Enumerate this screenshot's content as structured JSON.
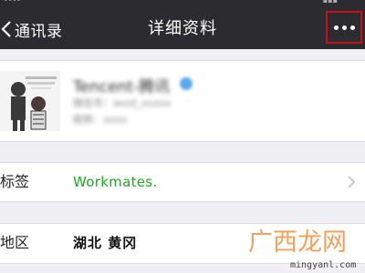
{
  "nav": {
    "back_label": "通讯录",
    "title": "详细资料"
  },
  "profile": {
    "name": "Tencent-腾讯",
    "subtitle": "微信号：wxid_xxxxx",
    "region_line": "昵称：xxxx"
  },
  "details": {
    "tags_label": "标签",
    "tags_value": "Workmates.",
    "region_label": "地区",
    "region_value": "湖北 黄冈"
  },
  "watermark": {
    "text": "广西龙网",
    "url": "mingyanl.com"
  },
  "colors": {
    "nav_bg": "#2c2c30",
    "highlight_border": "#c8101a",
    "tag_green": "#1aad19",
    "watermark_orange": "#f2a05a"
  }
}
